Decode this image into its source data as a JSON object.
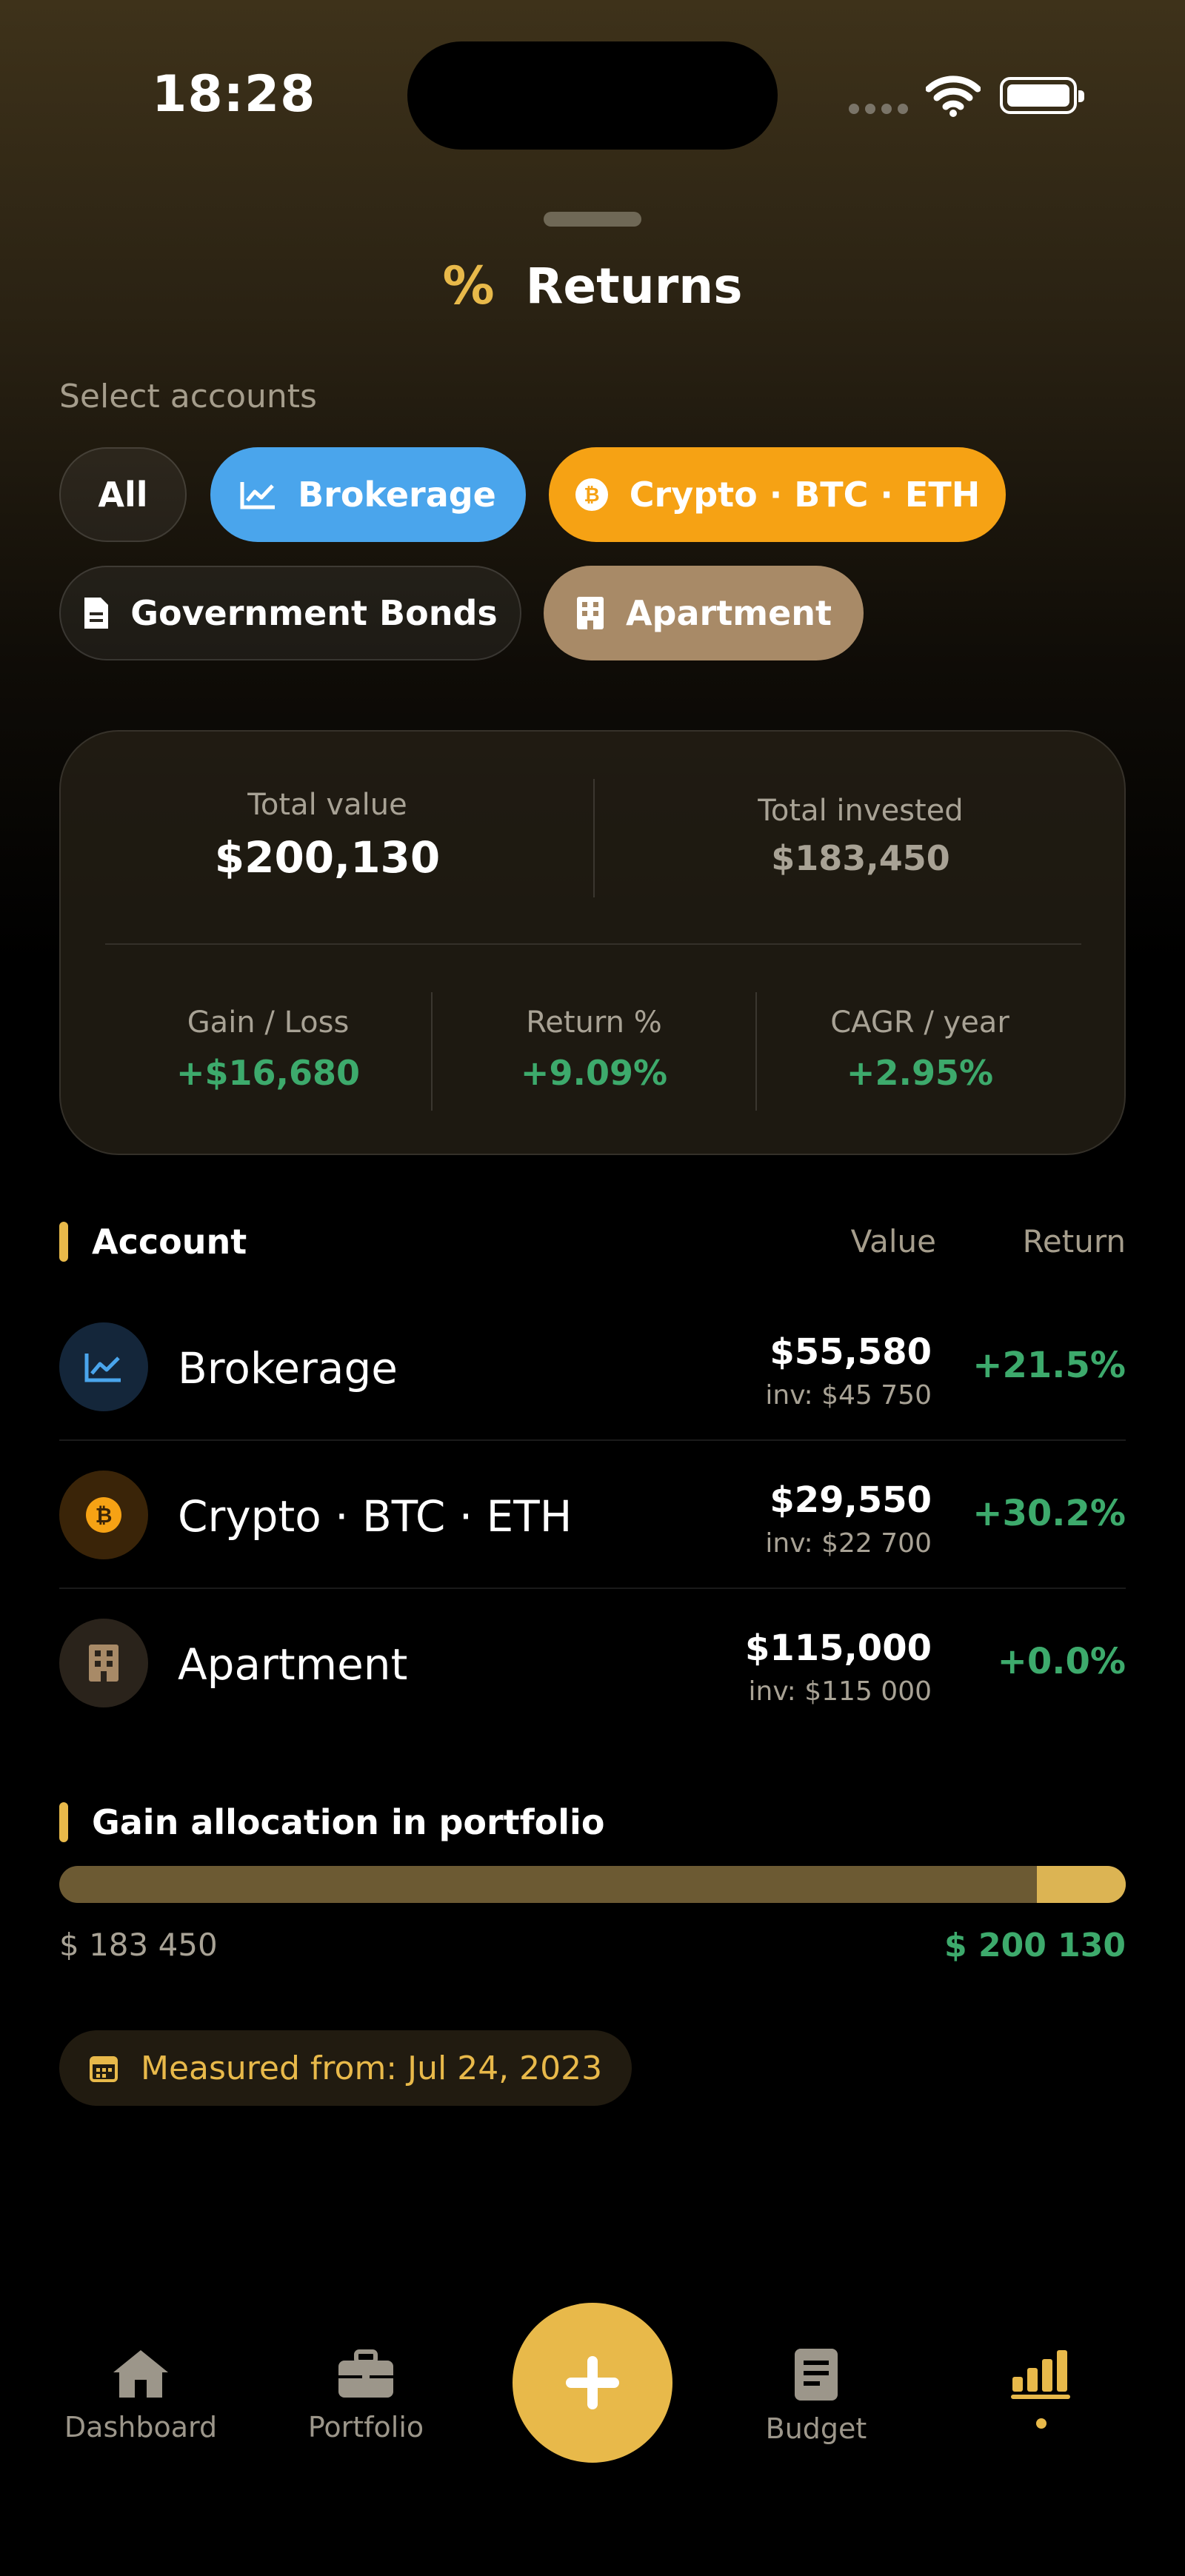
{
  "status": {
    "time": "18:28"
  },
  "header": {
    "icon": "%",
    "title": "Returns"
  },
  "filters": {
    "label": "Select accounts",
    "chips": [
      {
        "label": "All",
        "icon": "none",
        "color": "#2b2720"
      },
      {
        "label": "Brokerage",
        "icon": "chart-line-icon",
        "color": "#4aa5ec"
      },
      {
        "label": "Crypto · BTC · ETH",
        "icon": "bitcoin-icon",
        "color": "#f6a214"
      },
      {
        "label": "Government Bonds",
        "icon": "document-icon",
        "color": "#2b2720"
      },
      {
        "label": "Apartment",
        "icon": "building-icon",
        "color": "#a88a67"
      }
    ]
  },
  "summary": {
    "total_value_label": "Total value",
    "total_value": "$200,130",
    "total_invested_label": "Total invested",
    "total_invested": "$183,450",
    "gain_label": "Gain / Loss",
    "gain": "+$16,680",
    "return_label": "Return %",
    "return": "+9.09%",
    "cagr_label": "CAGR / year",
    "cagr": "+2.95%"
  },
  "accounts": {
    "header": "Account",
    "col_value": "Value",
    "col_return": "Return",
    "rows": [
      {
        "name": "Brokerage",
        "value": "$55,580",
        "invested": "inv: $45 750",
        "return": "+21.5%",
        "icon": "chart-line-icon"
      },
      {
        "name": "Crypto · BTC · ETH",
        "value": "$29,550",
        "invested": "inv: $22 700",
        "return": "+30.2%",
        "icon": "bitcoin-icon"
      },
      {
        "name": "Apartment",
        "value": "$115,000",
        "invested": "inv: $115 000",
        "return": "+0.0%",
        "icon": "building-icon"
      }
    ]
  },
  "gain_allocation": {
    "title": "Gain allocation in portfolio",
    "invested_label": "$ 183 450",
    "total_label": "$ 200 130",
    "invested_value": 183450,
    "total_value": 200130
  },
  "measured": {
    "text": "Measured from: Jul 24, 2023",
    "icon": "calendar-icon"
  },
  "tabbar": {
    "tabs": [
      {
        "label": "Dashboard",
        "icon": "house-icon"
      },
      {
        "label": "Portfolio",
        "icon": "briefcase-icon"
      },
      {
        "label": "",
        "icon": "plus-icon"
      },
      {
        "label": "Budget",
        "icon": "receipt-icon"
      },
      {
        "label": "",
        "icon": "bar-chart-icon"
      }
    ],
    "active_color": "#e8b94a"
  }
}
